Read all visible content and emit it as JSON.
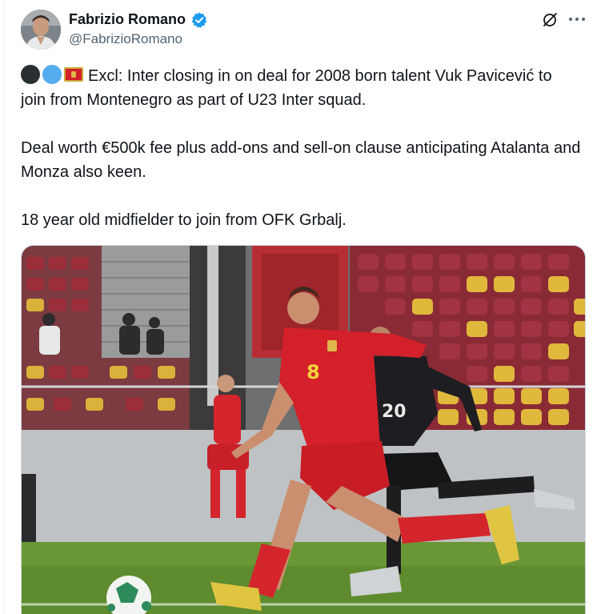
{
  "author": {
    "name": "Fabrizio Romano",
    "handle": "@FabrizioRomano",
    "verified": true
  },
  "icons": {
    "avatar": "profile-photo",
    "verified": "verified-badge-icon",
    "grok": "grok-icon",
    "more": "more-options-icon",
    "leading_emojis": [
      "black-circle",
      "blue-circle",
      "montenegro-flag"
    ]
  },
  "tweet": {
    "line1": "Excl: Inter closing in on deal for 2008 born talent Vuk Pavicević to join from Montenegro as part of U23 Inter squad.",
    "line2": "Deal worth €500k fee plus add-ons and sell-on clause anticipating Atalanta and Monza also keen.",
    "line3": "18 year old midfielder to join from OFK Grbalj."
  },
  "media": {
    "players": [
      {
        "team_color": "#d3202a",
        "shirt_number": "8"
      },
      {
        "team_color": "#1e1e22",
        "shirt_number": "20"
      }
    ]
  },
  "colors": {
    "verified_blue": "#1d9bf0",
    "text": "#0f1419",
    "secondary": "#536471"
  }
}
